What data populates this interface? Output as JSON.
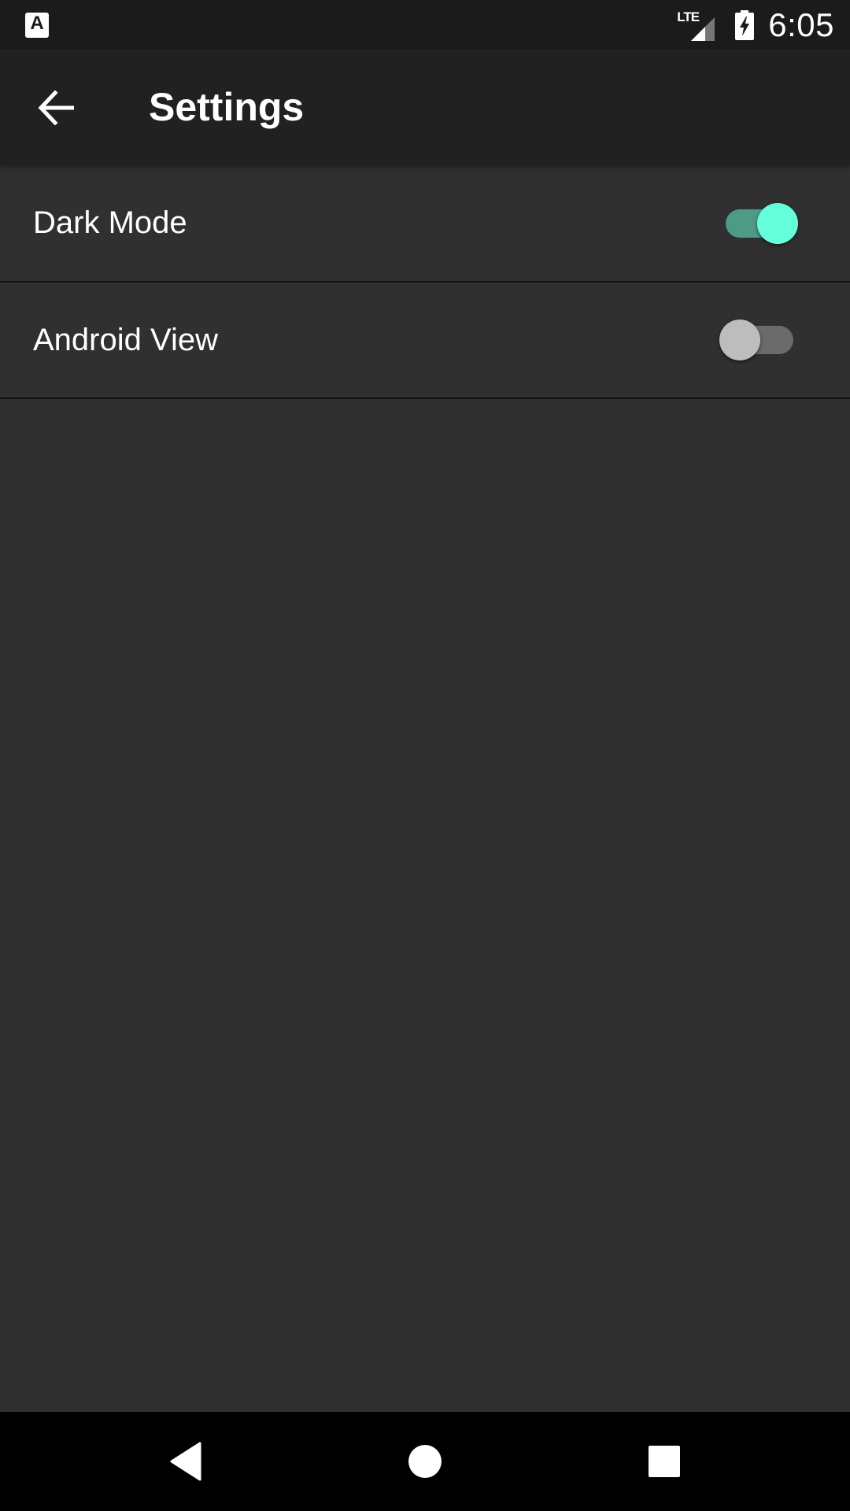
{
  "status_bar": {
    "app_icon_label": "A",
    "network_label": "LTE",
    "time": "6:05"
  },
  "toolbar": {
    "title": "Settings",
    "back_icon": "arrow-left-icon"
  },
  "settings": [
    {
      "label": "Dark Mode",
      "enabled": true
    },
    {
      "label": "Android View",
      "enabled": false
    }
  ],
  "colors": {
    "toggle_on_thumb": "#64ffda",
    "toggle_on_track": "#4e9a87",
    "toggle_off_thumb": "#bdbdbd",
    "toggle_off_track": "#6b6b6b",
    "background": "#303030",
    "toolbar": "#212121"
  },
  "nav_bar": {
    "icons": [
      "nav-back-icon",
      "home-icon",
      "recents-icon"
    ]
  }
}
